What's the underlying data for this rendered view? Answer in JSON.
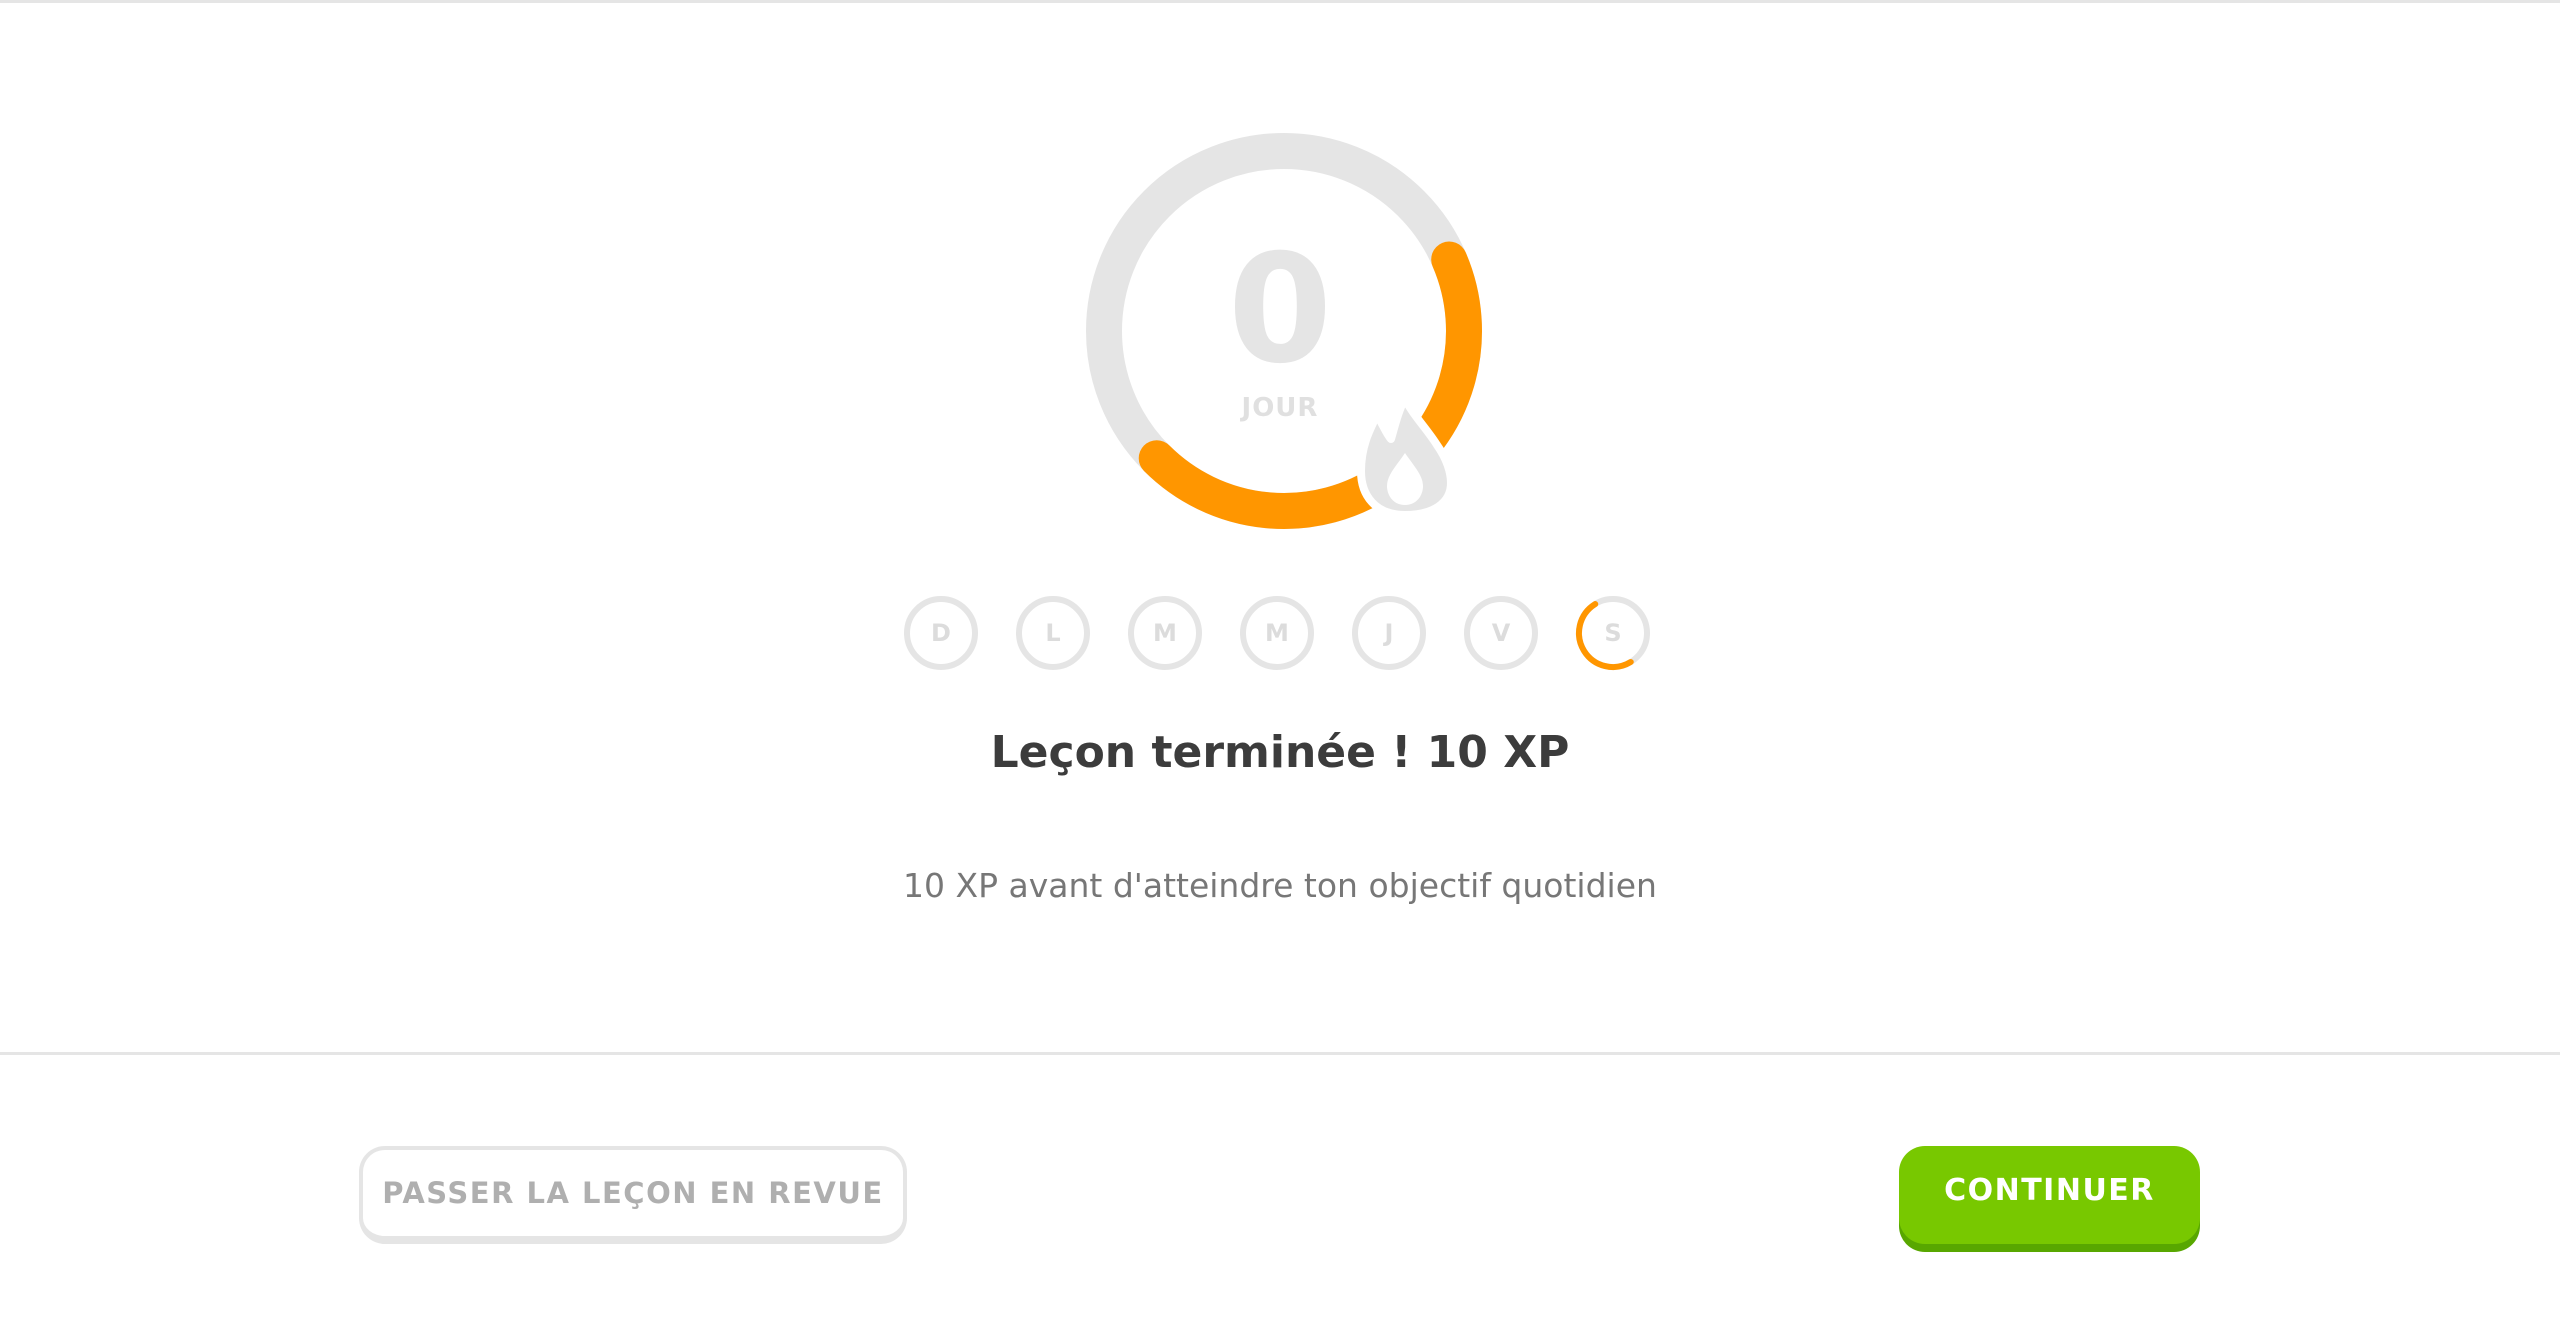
{
  "colors": {
    "accent_orange": "#ff9600",
    "ring_gray": "#e5e5e5",
    "continue_green": "#78c800",
    "continue_green_shadow": "#58a700",
    "title_text": "#3c3c3c",
    "subtitle_text": "#777777"
  },
  "streak": {
    "count": "0",
    "unit": "JOUR",
    "progress_fraction": 0.44,
    "icon": "flame-icon"
  },
  "week": {
    "days": [
      {
        "label": "D",
        "progress": 0
      },
      {
        "label": "L",
        "progress": 0
      },
      {
        "label": "M",
        "progress": 0
      },
      {
        "label": "M",
        "progress": 0
      },
      {
        "label": "J",
        "progress": 0
      },
      {
        "label": "V",
        "progress": 0
      },
      {
        "label": "S",
        "progress": 0.5
      }
    ]
  },
  "result": {
    "title": "Leçon terminée ! 10 XP",
    "subtitle": "10 XP avant d'atteindre ton objectif quotidien"
  },
  "footer": {
    "review_label": "PASSER LA LEÇON EN REVUE",
    "continue_label": "CONTINUER"
  }
}
